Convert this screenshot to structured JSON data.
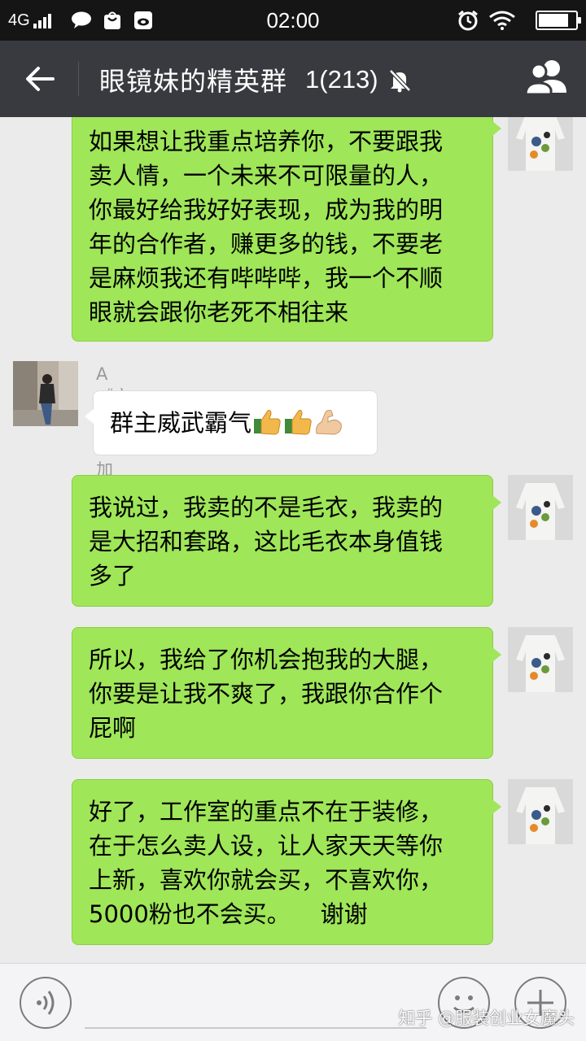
{
  "status_bar": {
    "network": "4G",
    "time": "02:00",
    "battery_level": 0.82,
    "icons": [
      "signal-icon",
      "chat-notification-icon",
      "bag-notification-icon",
      "weibo-notification-icon",
      "alarm-icon",
      "wifi-icon",
      "battery-icon"
    ]
  },
  "header": {
    "title": "眼镜妹的精英群",
    "member_count": "1(213)",
    "icons": [
      "back-arrow-icon",
      "mute-bell-icon",
      "group-members-icon"
    ]
  },
  "messages": [
    {
      "direction": "out",
      "lines": [
        "如果想让我重点培养你，不要跟我",
        "卖人情，一个未来不可限量的人，",
        "你最好给我好好表现，成为我的明",
        "年的合作者，赚更多的钱，不要老",
        "是麻烦我还有哔哔哔，我一个不顺",
        "眼就会跟你老死不相往来"
      ]
    },
    {
      "direction": "in",
      "sender": "A《衣情》禁止加我！谢谢！",
      "lines": [
        "群主威武霸气"
      ],
      "emoji": [
        "thumbs-up-emoji",
        "thumbs-up-emoji",
        "flexed-biceps-emoji"
      ]
    },
    {
      "direction": "out",
      "lines": [
        "我说过，我卖的不是毛衣，我卖的",
        "是大招和套路，这比毛衣本身值钱",
        "多了"
      ]
    },
    {
      "direction": "out",
      "lines": [
        "所以，我给了你机会抱我的大腿，",
        "你要是让我不爽了，我跟你合作个",
        "屁啊"
      ]
    },
    {
      "direction": "out",
      "lines": [
        "好了，工作室的重点不在于装修，",
        "在于怎么卖人设，让人家天天等你",
        "上新，喜欢你就会买，不喜欢你，",
        "5000粉也不会买。    谢谢"
      ]
    }
  ],
  "input_bar": {
    "icons": [
      "voice-icon",
      "emoji-face-icon",
      "plus-icon"
    ]
  },
  "watermark": "知乎 @服装创业女魔头",
  "colors": {
    "status_bar_bg": "#151515",
    "title_bar_bg": "#393a3f",
    "chat_bg": "#ebebeb",
    "out_bubble": "#9fe658",
    "in_bubble": "#ffffff"
  }
}
